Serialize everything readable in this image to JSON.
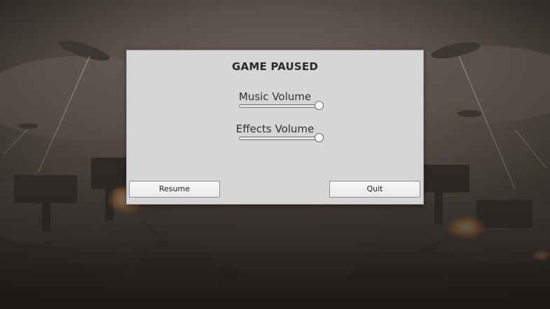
{
  "background": {
    "scene": "war-machines-battlefield"
  },
  "pause_menu": {
    "title": "GAME PAUSED",
    "sliders": [
      {
        "label": "Music Volume",
        "value": 1.0
      },
      {
        "label": "Effects Volume",
        "value": 1.0
      }
    ],
    "buttons": {
      "resume_label": "Resume",
      "quit_label": "Quit"
    }
  }
}
